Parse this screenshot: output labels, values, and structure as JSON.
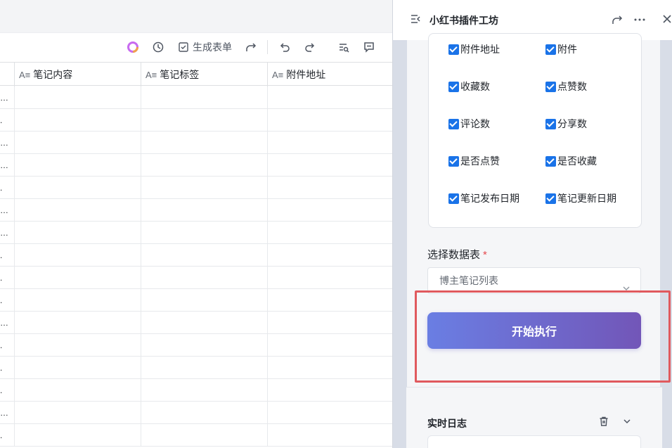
{
  "toolbar": {
    "generate_form_label": "生成表单"
  },
  "table": {
    "columns": [
      {
        "label": "笔记内容"
      },
      {
        "label": "笔记标签"
      },
      {
        "label": "附件地址"
      }
    ],
    "row_stubs": [
      "…",
      ".",
      "…",
      "…",
      ".",
      "…",
      "…",
      ".",
      ".",
      ".",
      "…",
      ".",
      ".",
      ".",
      "…",
      "."
    ]
  },
  "panel": {
    "title": "小红书插件工坊",
    "fields": [
      {
        "label": "附件地址",
        "checked": true
      },
      {
        "label": "附件",
        "checked": true
      },
      {
        "label": "收藏数",
        "checked": true
      },
      {
        "label": "点赞数",
        "checked": true
      },
      {
        "label": "评论数",
        "checked": true
      },
      {
        "label": "分享数",
        "checked": true
      },
      {
        "label": "是否点赞",
        "checked": true
      },
      {
        "label": "是否收藏",
        "checked": true
      },
      {
        "label": "笔记发布日期",
        "checked": true
      },
      {
        "label": "笔记更新日期",
        "checked": true
      }
    ],
    "select_table_label": "选择数据表",
    "required_mark": "*",
    "select_table_value": "博主笔记列表",
    "run_button_label": "开始执行",
    "log_title": "实时日志"
  },
  "colors": {
    "checkbox": "#1a73e8",
    "run_gradient_start": "#6a7ee3",
    "run_gradient_end": "#7256b8",
    "highlight_border": "#e05a5e"
  }
}
